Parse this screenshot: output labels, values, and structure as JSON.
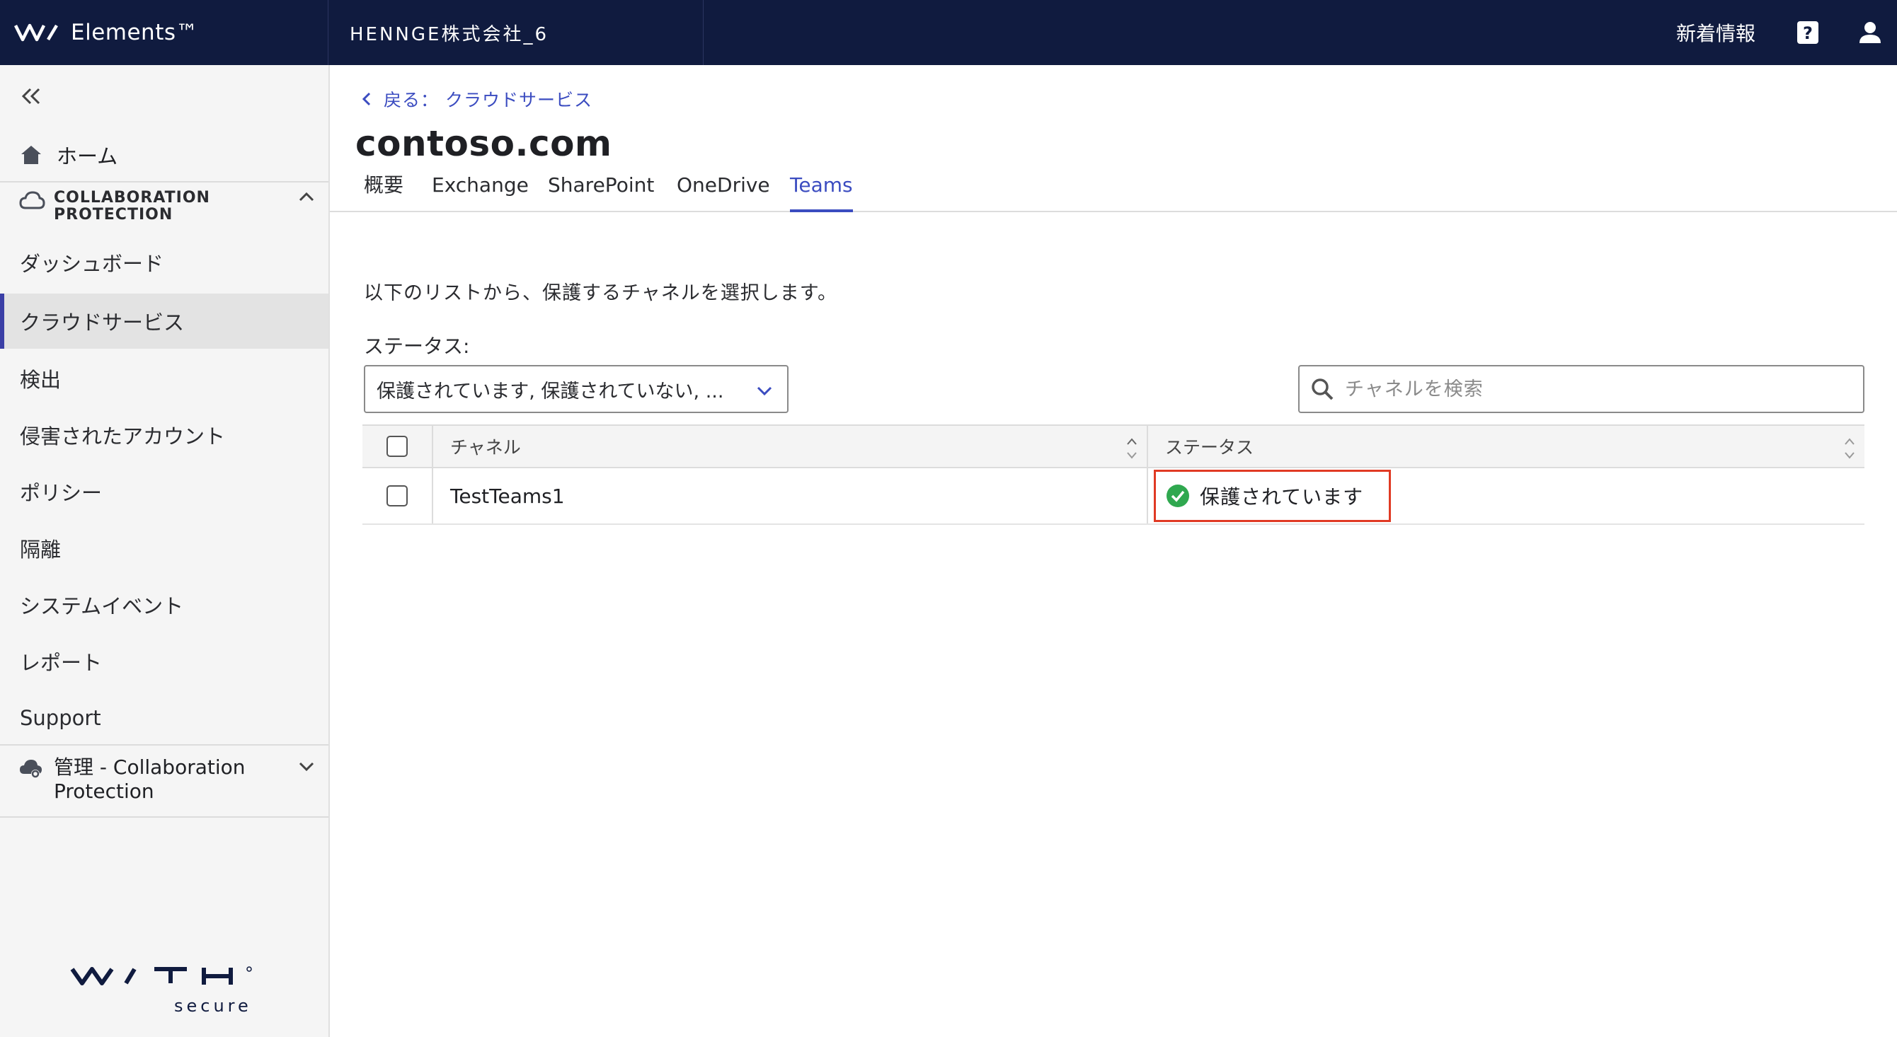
{
  "topbar": {
    "brand": "Elements™",
    "org": "HENNGE株式会社_6",
    "news": "新着情報"
  },
  "sidebar": {
    "home": "ホーム",
    "section_collab": "COLLABORATION PROTECTION",
    "items": [
      {
        "label": "ダッシュボード",
        "active": false
      },
      {
        "label": "クラウドサービス",
        "active": true
      },
      {
        "label": "検出",
        "active": false
      },
      {
        "label": "侵害されたアカウント",
        "active": false
      },
      {
        "label": "ポリシー",
        "active": false
      },
      {
        "label": "隔離",
        "active": false
      },
      {
        "label": "システムイベント",
        "active": false
      },
      {
        "label": "レポート",
        "active": false
      },
      {
        "label": "Support",
        "active": false
      }
    ],
    "section_admin": "管理 - Collaboration Protection"
  },
  "main": {
    "back": "戻る： クラウドサービス",
    "title": "contoso.com",
    "tabs": [
      {
        "label": "概要",
        "active": false
      },
      {
        "label": "Exchange",
        "active": false
      },
      {
        "label": "SharePoint",
        "active": false
      },
      {
        "label": "OneDrive",
        "active": false
      },
      {
        "label": "Teams",
        "active": true
      }
    ],
    "description": "以下のリストから、保護するチャネルを選択します。",
    "status_filter_label": "ステータス:",
    "status_filter_value": "保護されています, 保護されていない, ...",
    "search_placeholder": "チャネルを検索",
    "table": {
      "col_channel": "チャネル",
      "col_status": "ステータス",
      "rows": [
        {
          "channel": "TestTeams1",
          "status": "保護されています"
        }
      ]
    }
  },
  "colors": {
    "topbar": "#101b3f",
    "accent": "#3b4cc0",
    "ok": "#2fa84f",
    "highlight": "#e03a24"
  },
  "icons": [
    "collapse-icon",
    "home-icon",
    "cloud-icon",
    "chevron-up-icon",
    "chevron-down-icon",
    "cloud-gear-icon",
    "help-icon",
    "user-icon",
    "chevron-left-icon",
    "search-icon",
    "sort-icon",
    "check-circle-icon"
  ]
}
